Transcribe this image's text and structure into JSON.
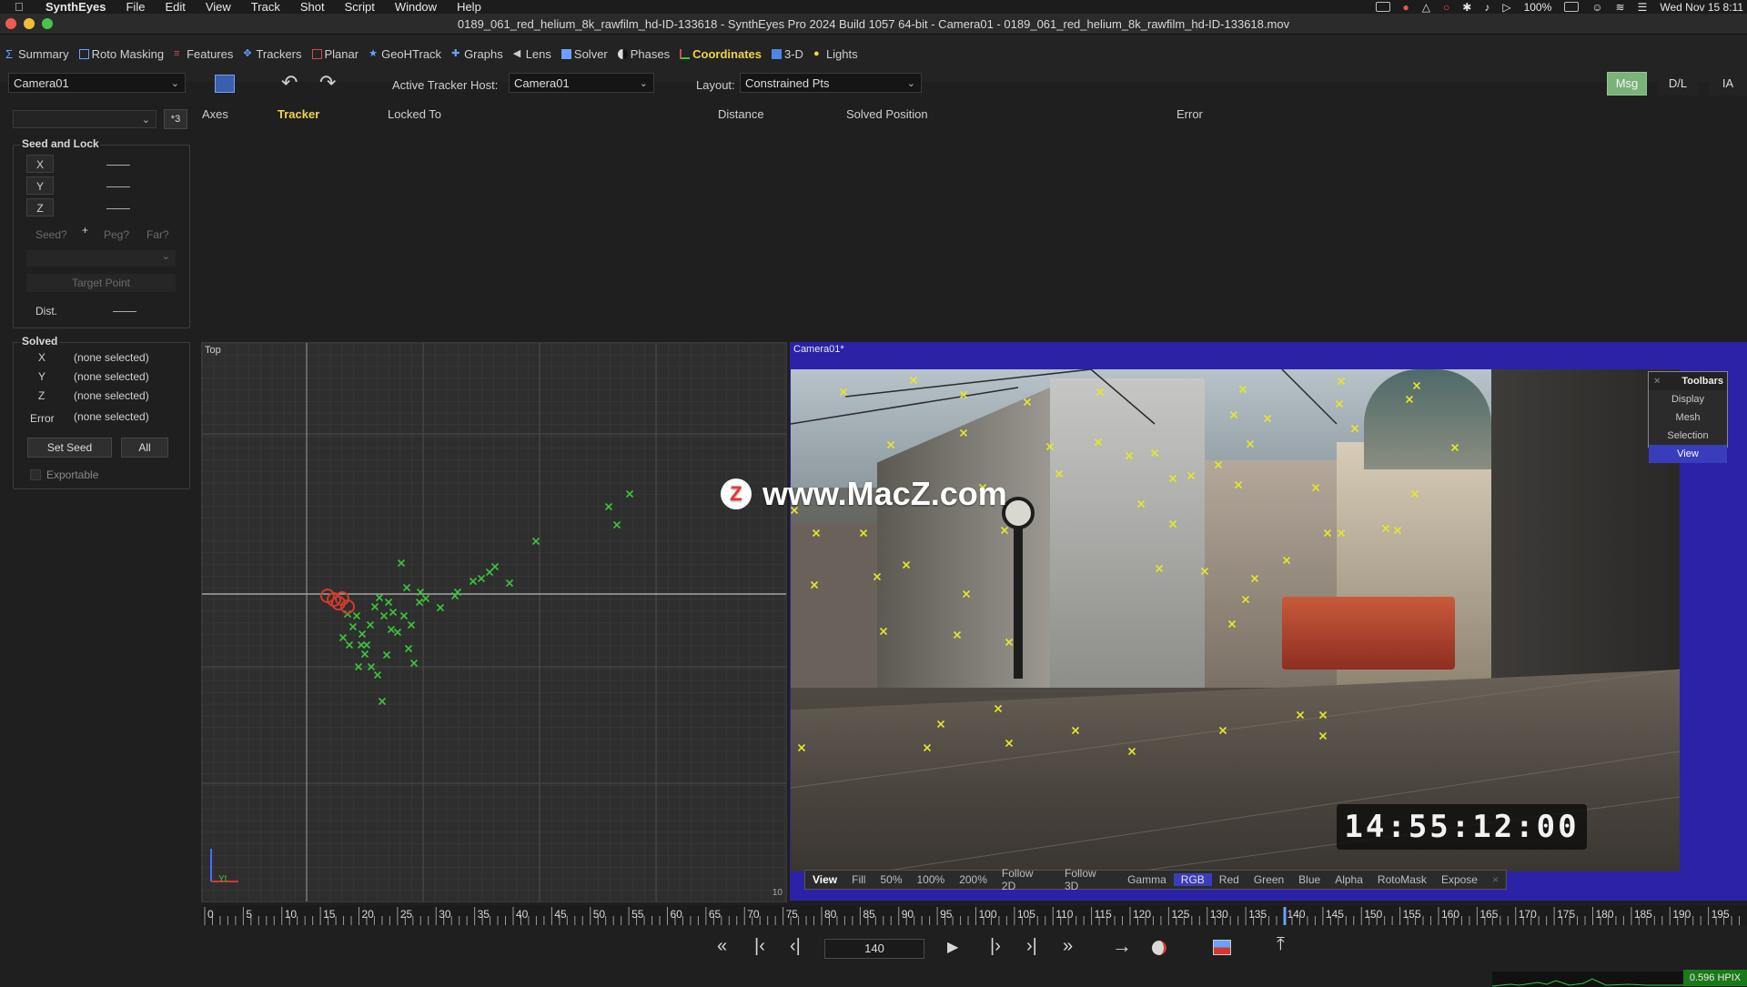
{
  "menubar": {
    "app": "SynthEyes",
    "items": [
      "File",
      "Edit",
      "View",
      "Track",
      "Shot",
      "Script",
      "Window",
      "Help"
    ],
    "battery": "100%",
    "clock": "Wed Nov 15  8:11"
  },
  "window": {
    "title": "0189_061_red_helium_8k_rawfilm_hd-ID-133618 - SynthEyes Pro 2024 Build 1057 64-bit - Camera01 - 0189_061_red_helium_8k_rawfilm_hd-ID-133618.mov"
  },
  "rooms": [
    {
      "label": "Summary",
      "icon": "sigma-icon",
      "color": "#6aa0ff"
    },
    {
      "label": "Roto Masking",
      "icon": "roto-icon",
      "color": "#6aa0ff"
    },
    {
      "label": "Features",
      "icon": "features-icon",
      "color": "#d24b4b"
    },
    {
      "label": "Trackers",
      "icon": "trackers-icon",
      "color": "#6aa0ff"
    },
    {
      "label": "Planar",
      "icon": "planar-icon",
      "color": "#d24b4b"
    },
    {
      "label": "GeoHTrack",
      "icon": "geohtrack-icon",
      "color": "#6aa0ff"
    },
    {
      "label": "Graphs",
      "icon": "graphs-icon",
      "color": "#6aa0ff"
    },
    {
      "label": "Lens",
      "icon": "lens-icon",
      "color": "#cccccc"
    },
    {
      "label": "Solver",
      "icon": "solver-icon",
      "color": "#6aa0ff"
    },
    {
      "label": "Phases",
      "icon": "phases-icon",
      "color": "#dddddd"
    },
    {
      "label": "Coordinates",
      "icon": "coordinates-icon",
      "color": "#f2d34a"
    },
    {
      "label": "3-D",
      "icon": "cube-icon",
      "color": "#6aa0ff"
    },
    {
      "label": "Lights",
      "icon": "bulb-icon",
      "color": "#f2d34a"
    }
  ],
  "active_room": "Coordinates",
  "toolbar": {
    "camera_select": "Camera01",
    "active_tracker_host_label": "Active Tracker Host:",
    "active_tracker_host_value": "Camera01",
    "layout_label": "Layout:",
    "layout_value": "Constrained Pts",
    "msg": "Msg",
    "dl": "D/L",
    "ia": "IA"
  },
  "left_panel": {
    "dropdown_value": "",
    "star_button": "*3",
    "seed_lock": {
      "title": "Seed and Lock",
      "axes": [
        "X",
        "Y",
        "Z"
      ],
      "seed": "Seed?",
      "plus": "+",
      "peg": "Peg?",
      "far": "Far?",
      "target_point": "Target Point",
      "dist_label": "Dist."
    },
    "solved": {
      "title": "Solved",
      "rows": [
        {
          "axis": "X",
          "value": "(none selected)"
        },
        {
          "axis": "Y",
          "value": "(none selected)"
        },
        {
          "axis": "Z",
          "value": "(none selected)"
        },
        {
          "axis": "Error",
          "value": "(none selected)"
        }
      ],
      "set_seed": "Set Seed",
      "all": "All",
      "exportable": "Exportable"
    }
  },
  "table": {
    "columns": [
      "Axes",
      "Tracker",
      "Locked To",
      "Distance",
      "Solved Position",
      "Error"
    ]
  },
  "top_view": {
    "label": "Top",
    "corner_label": "10",
    "axis_label": "Yt"
  },
  "camera_view": {
    "label": "Camera01*",
    "timecode": "14:55:12:00",
    "view_toolbar": [
      "View",
      "Fill",
      "50%",
      "100%",
      "200%",
      "Follow 2D",
      "Follow 3D",
      "Gamma",
      "RGB",
      "Red",
      "Green",
      "Blue",
      "Alpha",
      "RotoMask",
      "Expose"
    ],
    "view_toolbar_selected": "RGB",
    "toolbars_menu": {
      "title": "Toolbars",
      "items": [
        "Display",
        "Mesh",
        "Selection",
        "View"
      ],
      "selected": "View"
    }
  },
  "timeline": {
    "ticks": [
      "0",
      "5",
      "10",
      "15",
      "20",
      "25",
      "30",
      "35",
      "40",
      "45",
      "50",
      "55",
      "60",
      "65",
      "70",
      "75",
      "80",
      "85",
      "90",
      "95",
      "100",
      "105",
      "110",
      "115",
      "120",
      "125",
      "130",
      "135",
      "140",
      "145",
      "150",
      "155",
      "160",
      "165",
      "170",
      "175",
      "180",
      "185",
      "190",
      "195",
      "20"
    ],
    "current_frame": 140
  },
  "transport": {
    "frame_value": "140"
  },
  "status": {
    "hpix": "0.596 HPIX"
  },
  "watermark": {
    "logo_letter": "Z",
    "text": "www.MacZ.com"
  },
  "colors": {
    "accent_tab": "#f2d34a",
    "tracker_green": "#3ec23e",
    "tracker_yellow": "#e6e62a",
    "tracker_red": "#d13a2e",
    "camera_bg": "#2b22a8",
    "msg_button": "#7bb27a"
  }
}
